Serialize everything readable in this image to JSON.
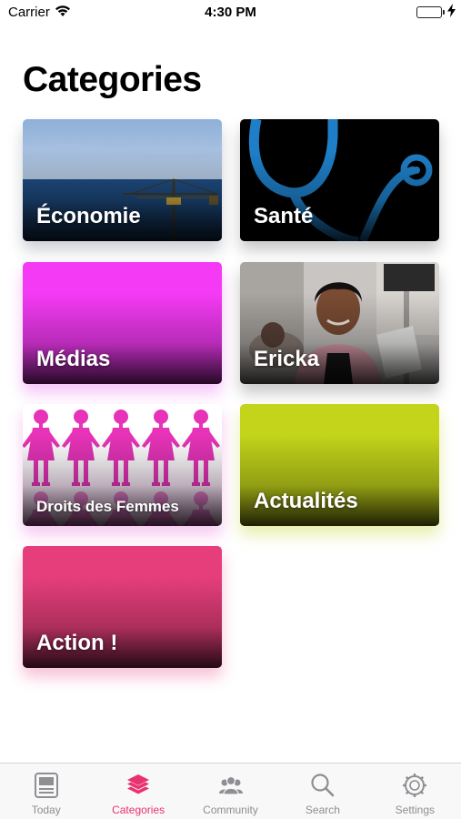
{
  "status_bar": {
    "carrier": "Carrier",
    "time": "4:30 PM",
    "battery_level": 1.0
  },
  "page": {
    "title": "Categories"
  },
  "categories": [
    {
      "label": "Économie",
      "image": "harbor-crane-photo"
    },
    {
      "label": "Santé",
      "image": "stethoscope-photo",
      "color": "#1e7fc8"
    },
    {
      "label": "Médias",
      "color": "#f53af5"
    },
    {
      "label": "Ericka",
      "image": "woman-portrait-photo"
    },
    {
      "label": "Droits des Femmes",
      "image": "paper-dolls-illustration",
      "color": "#e633b8"
    },
    {
      "label": "Actualités",
      "color": "#c3d41a"
    },
    {
      "label": "Action !",
      "color": "#e63e7a"
    }
  ],
  "tab_bar": {
    "active_color": "#e8336f",
    "inactive_color": "#8e8e93",
    "tabs": [
      {
        "label": "Today",
        "icon": "newspaper-icon"
      },
      {
        "label": "Categories",
        "icon": "layers-icon",
        "active": true
      },
      {
        "label": "Community",
        "icon": "people-icon"
      },
      {
        "label": "Search",
        "icon": "magnifier-icon"
      },
      {
        "label": "Settings",
        "icon": "gear-icon"
      }
    ]
  }
}
